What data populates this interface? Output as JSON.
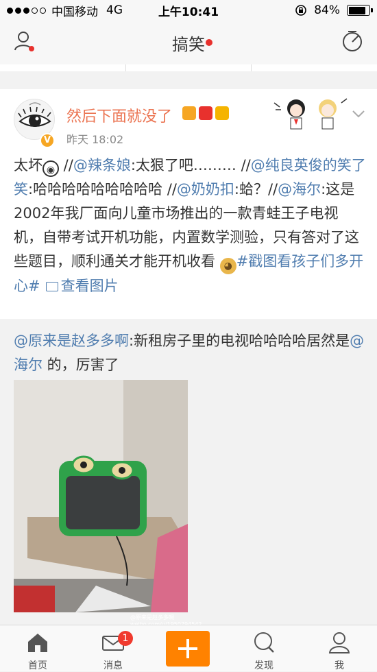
{
  "status_bar": {
    "carrier": "中国移动",
    "network": "4G",
    "time": "上午10:41",
    "battery": "84%",
    "battery_level": 0.84
  },
  "nav": {
    "title": "搞笑"
  },
  "post": {
    "username": "然后下面就没了",
    "badges": [
      "VIP",
      "红包",
      "财"
    ],
    "timestamp": "昨天 18:02",
    "segments": [
      {
        "text": "太坏",
        "link": false
      },
      {
        "emoji": "ghost-emoji"
      },
      {
        "text": " //",
        "link": false
      },
      {
        "text": "@辣条娘",
        "link": true
      },
      {
        "text": ":太狠了吧……… //",
        "link": false
      },
      {
        "text": "@纯良英俊的笑了笑",
        "link": true
      },
      {
        "text": ":哈哈哈哈哈哈哈哈哈 //",
        "link": false
      },
      {
        "text": "@奶奶扣",
        "link": true
      },
      {
        "text": ":蛤？//",
        "link": false
      },
      {
        "text": "@海尔",
        "link": true
      },
      {
        "text": ":这是2002年我厂面向儿童市场推出的一款青蛙王子电视机，自带考试开机功能，内置数学测验，只有答对了这些题目，顺利通关才能开机收看 ",
        "link": false
      },
      {
        "emoji": "doge-emoji"
      },
      {
        "text": "#戳图看孩子们多开心#",
        "link": true
      }
    ],
    "view_image_label": "查看图片"
  },
  "repost": {
    "segments": [
      {
        "text": "@原来是赵多多啊",
        "link": true
      },
      {
        "text": ":新租房子里的电视哈哈哈哈居然是",
        "link": false
      },
      {
        "text": "@海尔",
        "link": true
      },
      {
        "text": " 的，厉害了",
        "link": false
      }
    ],
    "watermark": "@原来是赵多多啊 weibo.com/u/1950794542"
  },
  "tab_bar": {
    "tabs": [
      {
        "label": "首页",
        "icon": "home-icon"
      },
      {
        "label": "消息",
        "icon": "mail-icon",
        "badge": "1"
      },
      {
        "label": "",
        "icon": "compose-plus-icon"
      },
      {
        "label": "发现",
        "icon": "search-icon"
      },
      {
        "label": "我",
        "icon": "profile-icon"
      }
    ]
  },
  "colors": {
    "accent": "#ff8200",
    "link": "#507daf",
    "username": "#eb7350",
    "badge_red": "#f03a2e"
  }
}
